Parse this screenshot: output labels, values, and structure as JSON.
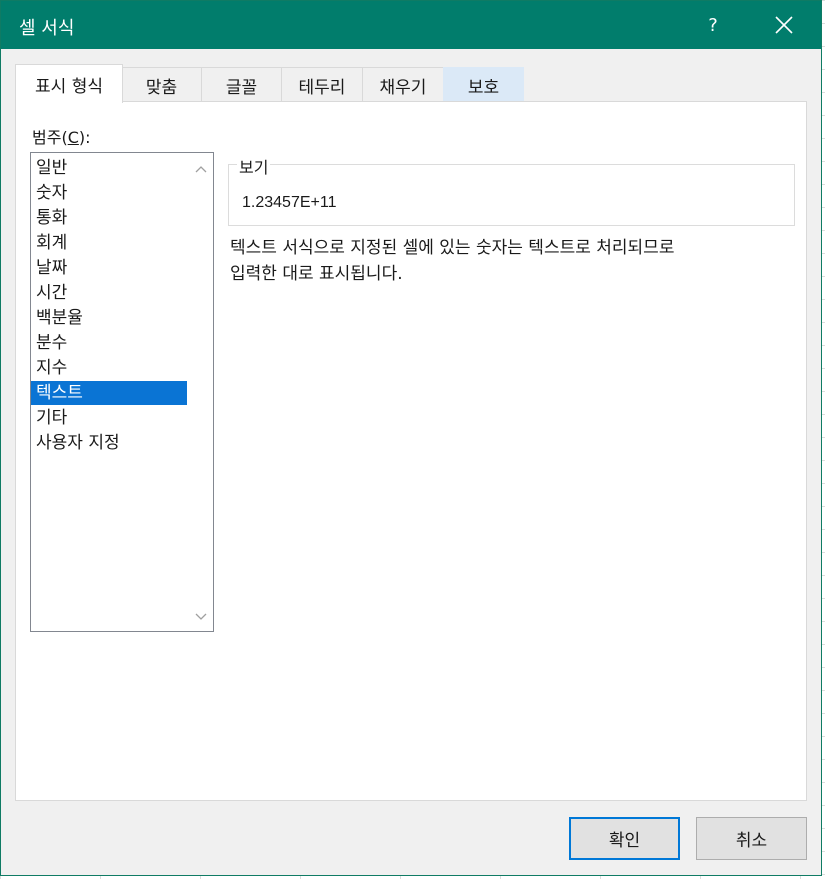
{
  "window": {
    "title": "셀 서식",
    "help_label": "?",
    "titlebar_color": "#017d6c"
  },
  "tabs": [
    {
      "label": "표시 형식",
      "active": true
    },
    {
      "label": "맞춤",
      "active": false
    },
    {
      "label": "글꼴",
      "active": false
    },
    {
      "label": "테두리",
      "active": false
    },
    {
      "label": "채우기",
      "active": false
    },
    {
      "label": "보호",
      "active": false,
      "hover": true
    }
  ],
  "category": {
    "label_prefix": "범주(",
    "label_mnemonic": "C",
    "label_suffix": "):",
    "items": [
      "일반",
      "숫자",
      "통화",
      "회계",
      "날짜",
      "시간",
      "백분율",
      "분수",
      "지수",
      "텍스트",
      "기타",
      "사용자 지정"
    ],
    "selected": "텍스트",
    "selection_color": "#0a74d4"
  },
  "preview": {
    "legend": "보기",
    "value": "1.23457E+11"
  },
  "description": "텍스트 서식으로 지정된 셀에 있는 숫자는 텍스트로 처리되므로\n입력한 대로 표시됩니다.",
  "buttons": {
    "ok": "확인",
    "cancel": "취소"
  }
}
